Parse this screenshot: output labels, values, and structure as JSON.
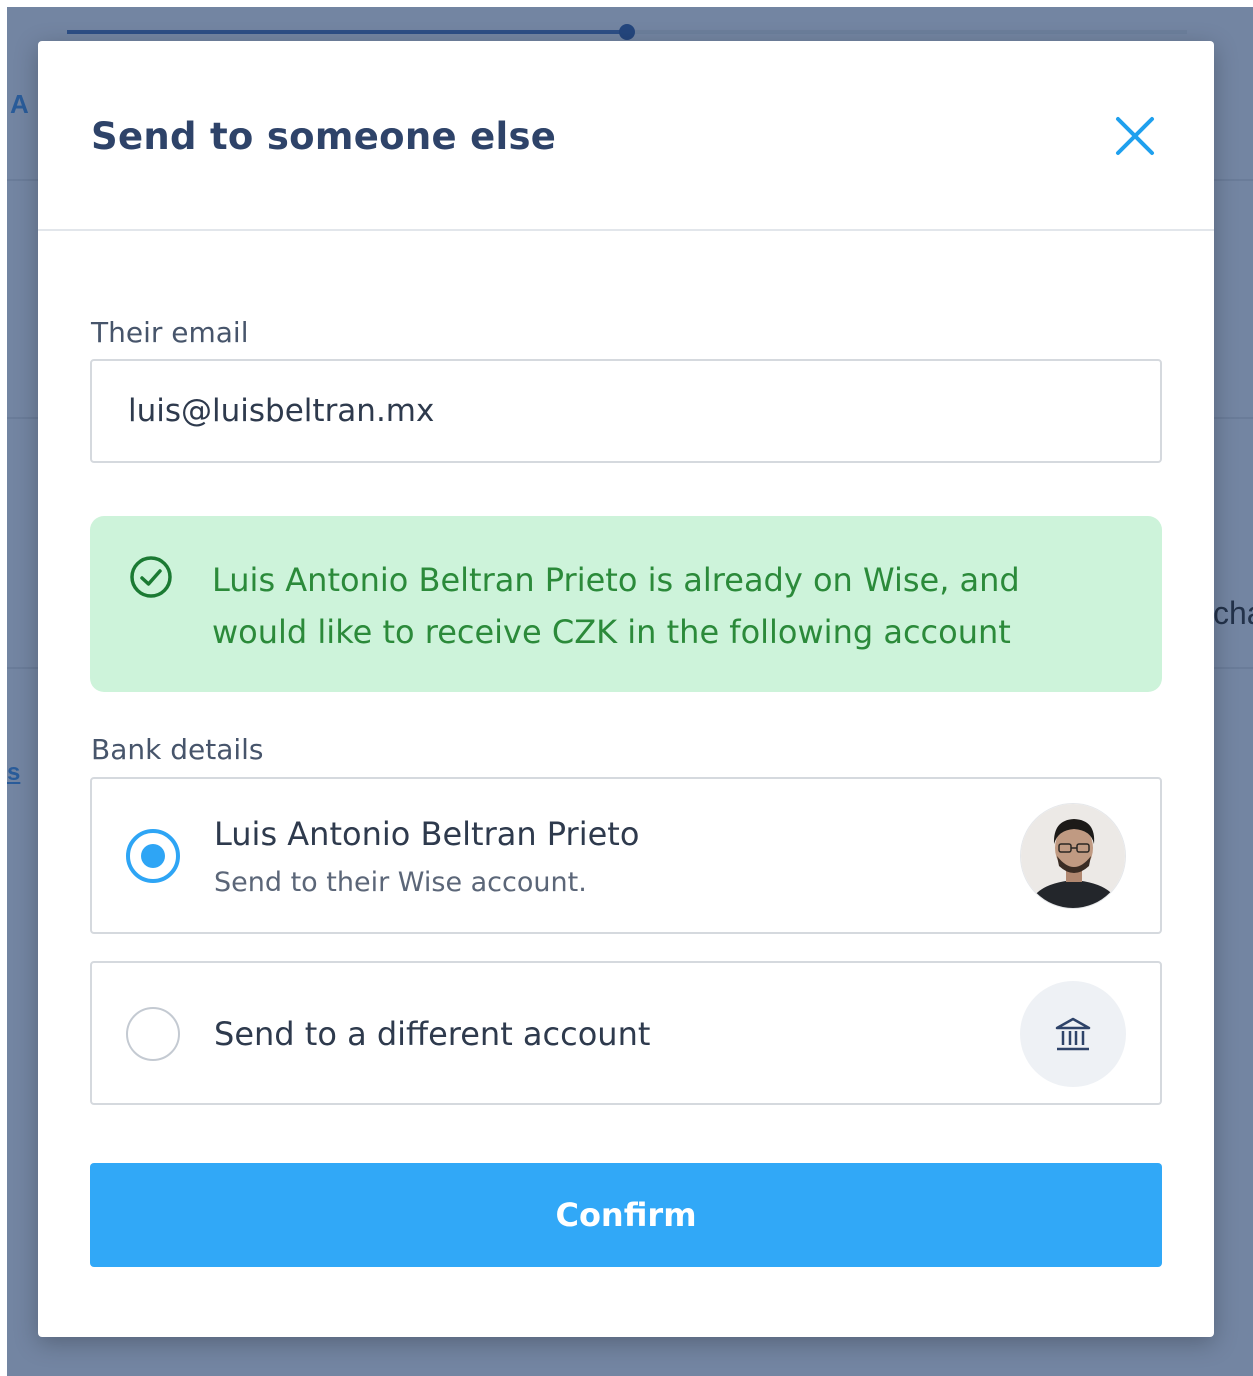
{
  "background": {
    "fragment_left_top": "A",
    "fragment_left_link": "s",
    "fragment_right": "cha",
    "progress_fraction": 0.5
  },
  "modal": {
    "title": "Send to someone else",
    "close_icon": "close-x-icon",
    "email": {
      "label": "Their email",
      "value": "luis@luisbeltran.mx"
    },
    "alert": {
      "icon": "check-circle-icon",
      "text": "Luis Antonio Beltran Prieto is already on Wise, and would like to receive CZK in the following account"
    },
    "bank_details": {
      "label": "Bank details",
      "options": [
        {
          "title": "Luis Antonio Beltran Prieto",
          "subtitle": "Send to their Wise account.",
          "selected": true,
          "icon": "avatar"
        },
        {
          "title": "Send to a different account",
          "selected": false,
          "icon": "bank-icon"
        }
      ]
    },
    "confirm_label": "Confirm"
  },
  "colors": {
    "accent": "#31a8f7",
    "success_bg": "#cdf3da",
    "success_text": "#2b8a3a",
    "title": "#2e4369"
  }
}
